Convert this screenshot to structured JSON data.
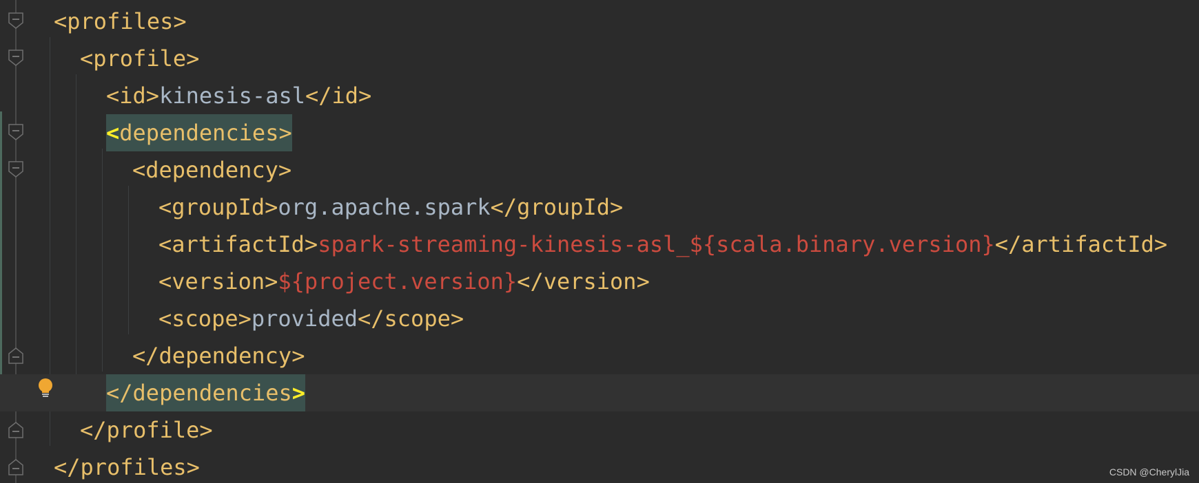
{
  "editor": {
    "language": "xml",
    "theme_colors": {
      "background": "#2b2b2b",
      "tag": "#e8bf6a",
      "text": "#a9b7c6",
      "property_reference": "#cc4b3f",
      "brace_match": "#ffef28",
      "highlight": "#3b514d"
    },
    "lines": [
      {
        "open": "<profiles>"
      },
      {
        "open": "<profile>"
      },
      {
        "open": "<id>",
        "value": "kinesis-asl",
        "close": "</id>"
      },
      {
        "bracket": "<",
        "rest": "dependencies>"
      },
      {
        "open": "<dependency>"
      },
      {
        "open": "<groupId>",
        "value": "org.apache.spark",
        "close": "</groupId>"
      },
      {
        "open": "<artifactId>",
        "value": "spark-streaming-kinesis-asl_${scala.binary.version}",
        "close": "</artifactId>"
      },
      {
        "open": "<version>",
        "value": "${project.version}",
        "close": "</version>"
      },
      {
        "open": "<scope>",
        "value": "provided",
        "close": "</scope>"
      },
      {
        "close": "</dependency>"
      },
      {
        "rest": "</dependencies",
        "bracket": ">"
      },
      {
        "close": "</profile>"
      },
      {
        "close": "</profiles>"
      }
    ],
    "intention_icon": "lightbulb-icon",
    "fold_icons": [
      "fold-open-icon",
      "fold-close-icon"
    ]
  },
  "watermark": "CSDN @CherylJia"
}
